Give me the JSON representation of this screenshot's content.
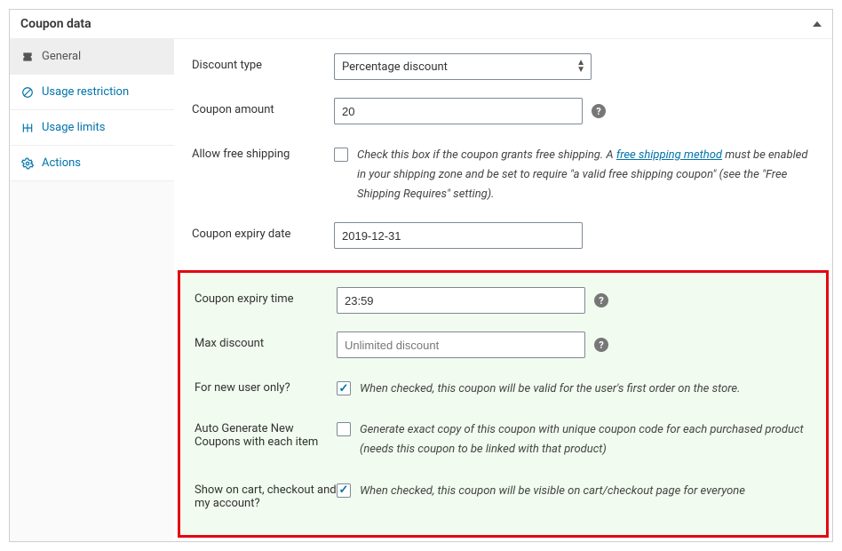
{
  "panel": {
    "title": "Coupon data"
  },
  "tabs": {
    "general": "General",
    "usage_restriction": "Usage restriction",
    "usage_limits": "Usage limits",
    "actions": "Actions"
  },
  "fields": {
    "discount_type": {
      "label": "Discount type",
      "value": "Percentage discount"
    },
    "coupon_amount": {
      "label": "Coupon amount",
      "value": "20"
    },
    "free_shipping": {
      "label": "Allow free shipping",
      "checked": false,
      "before": "Check this box if the coupon grants free shipping. A ",
      "link": "free shipping method",
      "after": " must be enabled in your shipping zone and be set to require \"a valid free shipping coupon\" (see the \"Free Shipping Requires\" setting)."
    },
    "expiry_date": {
      "label": "Coupon expiry date",
      "value": "2019-12-31"
    },
    "expiry_time": {
      "label": "Coupon expiry time",
      "value": "23:59"
    },
    "max_discount": {
      "label": "Max discount",
      "placeholder": "Unlimited discount"
    },
    "new_user": {
      "label": "For new user only?",
      "checked": true,
      "desc": "When checked, this coupon will be valid for the user's first order on the store."
    },
    "auto_generate": {
      "label": "Auto Generate New Coupons with each item",
      "checked": false,
      "desc": "Generate exact copy of this coupon with unique coupon code for each purchased product (needs this coupon to be linked with that product)"
    },
    "show_on": {
      "label": "Show on cart, checkout and my account?",
      "checked": true,
      "desc": "When checked, this coupon will be visible on cart/checkout page for everyone"
    }
  }
}
